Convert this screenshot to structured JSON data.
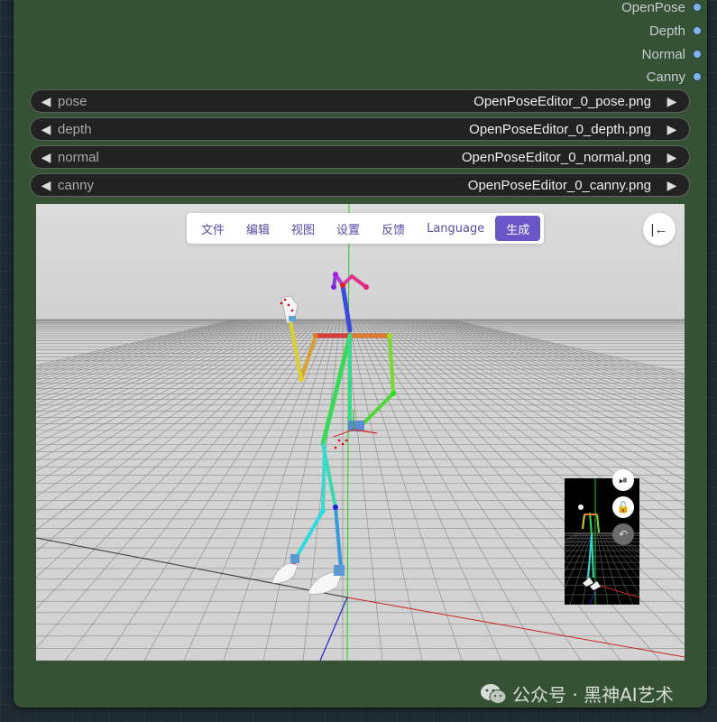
{
  "outputs": [
    {
      "label": "OpenPose"
    },
    {
      "label": "Depth"
    },
    {
      "label": "Normal"
    },
    {
      "label": "Canny"
    }
  ],
  "combos": [
    {
      "label": "pose",
      "value": "OpenPoseEditor_0_pose.png"
    },
    {
      "label": "depth",
      "value": "OpenPoseEditor_0_depth.png"
    },
    {
      "label": "normal",
      "value": "OpenPoseEditor_0_normal.png"
    },
    {
      "label": "canny",
      "value": "OpenPoseEditor_0_canny.png"
    }
  ],
  "menu": {
    "file": "文件",
    "edit": "编辑",
    "view": "视图",
    "settings": "设置",
    "feedback": "反馈",
    "language": "Language",
    "generate": "生成"
  },
  "icons": {
    "combo_left": "◀",
    "combo_right": "▶",
    "collapse": "|←",
    "preview_play": "⏯",
    "preview_lock": "🔓",
    "preview_undo": "↶"
  },
  "watermark": {
    "text": "公众号 · 黑神AI艺术"
  },
  "colors": {
    "node_bg": "#355234",
    "canvas_bg": "#1f2a33",
    "slot_dot": "#7fb4e8",
    "accent": "#6b56c8"
  }
}
